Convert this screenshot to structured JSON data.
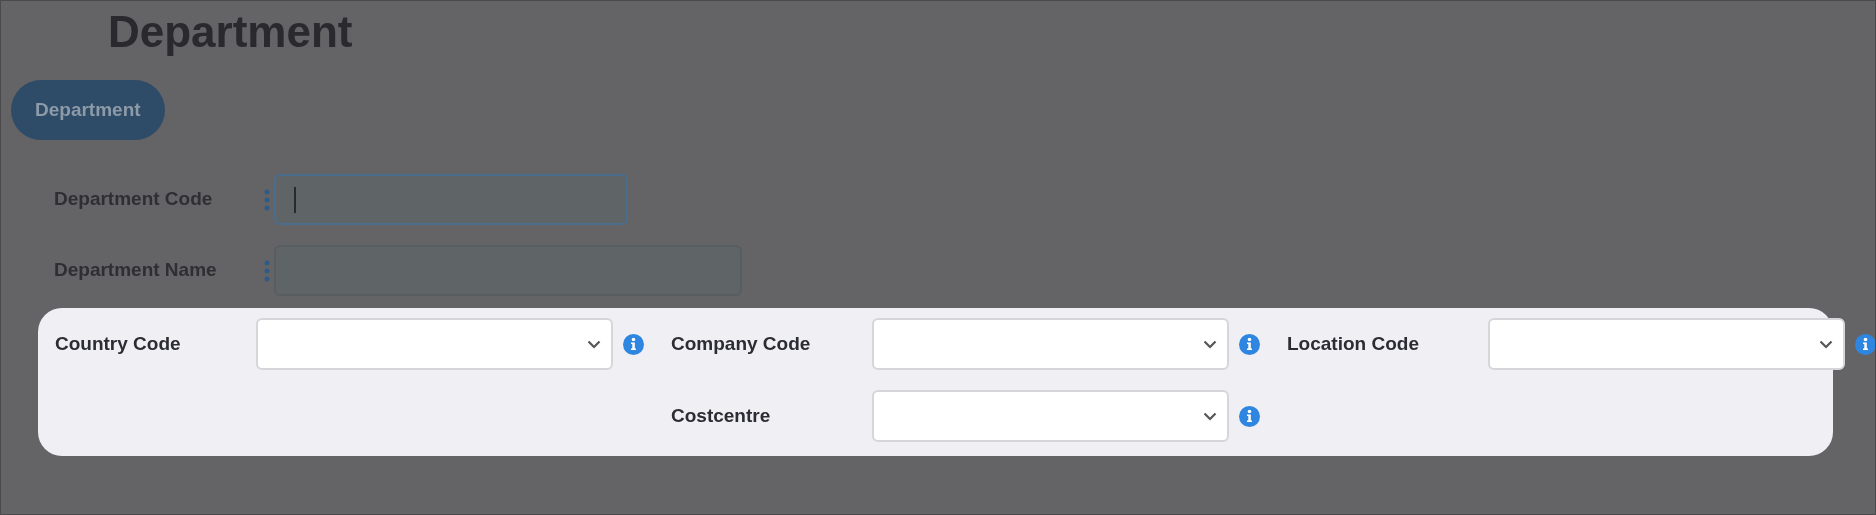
{
  "title": "Department",
  "tab_button": {
    "label": "Department"
  },
  "text_fields": [
    {
      "label": "Department Code",
      "focused": true,
      "wide": false
    },
    {
      "label": "Department Name",
      "focused": false,
      "wide": true
    }
  ],
  "highlighted_panel": {
    "rows": [
      [
        {
          "label": "Country Code"
        },
        {
          "label": "Company Code"
        },
        {
          "label": "Location Code"
        }
      ],
      [
        null,
        {
          "label": "Costcentre"
        }
      ]
    ]
  }
}
